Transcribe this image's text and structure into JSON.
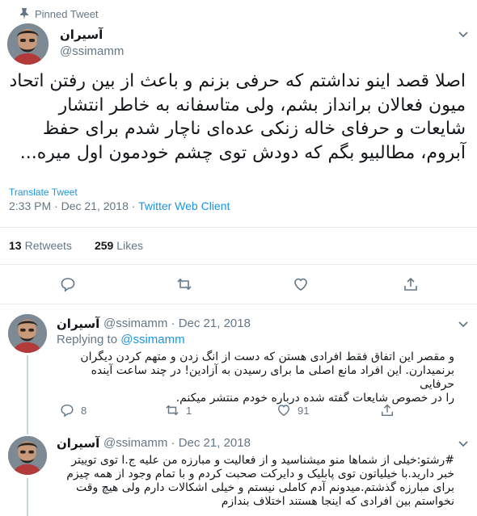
{
  "pinned": {
    "label": "Pinned Tweet"
  },
  "main_tweet": {
    "display_name": "آسیران",
    "handle": "@ssimamm",
    "text_lines": [
      "اصلا قصد اینو نداشتم که حرفی بزنم و باعث از بین رفتن اتحاد",
      "میون فعالان برانداز بشم، ولی متاسفانه به خاطر انتشار",
      "شایعات و حرفای خاله زنکی عده‌ای ناچار شدم برای حفظ",
      "آبروم، مطالبیو بگم که دودش توی چشم خودمون اول میره..."
    ],
    "translate_label": "Translate Tweet",
    "time": "2:33 PM · Dec 21, 2018 · ",
    "client": "Twitter Web Client",
    "retweets_count": "13",
    "retweets_label": "Retweets",
    "likes_count": "259",
    "likes_label": "Likes"
  },
  "replies": [
    {
      "display_name": "آسیران",
      "handle": "@ssimamm · Dec 21, 2018",
      "replying_prefix": "Replying to ",
      "replying_to": "@ssimamm",
      "text_lines": [
        "و مقصر این اتفاق فقط افرادی هستن که دست از انگ زدن و متهم کردن دیگران",
        "برنمیدارن. این افراد مانع اصلی ما برای رسیدن به آزادین! در چند ساعت  آینده حرفایی",
        "را در خصوص شایعات گفته شده درباره خودم منتشر میکنم."
      ],
      "reply_count": "8",
      "retweet_count": "1",
      "like_count": "91"
    },
    {
      "display_name": "آسیران",
      "handle": "@ssimamm · Dec 21, 2018",
      "text_lines": [
        "#رشتو:خیلی از شماها منو میشناسید و از فعالیت و مبارزه من علیه ج.ا توی توییتر",
        "خبر دارید.با خیلیاتون توی پابلیک و دایرکت صحبت کردم و با تمام وجود از همه چیزم",
        "برای مبارزه گذشتم.میدونم آدم کاملی نیستم و خیلی اشکالات دارم ولی هیچ وقت",
        "نخواستم بین افرادی که اینجا هستند اختلاف بندازم"
      ]
    }
  ],
  "colors": {
    "link": "#1b95e0",
    "muted": "#657786",
    "text": "#14171a",
    "divider": "#e6ecf0"
  },
  "icons": [
    "pin-icon",
    "chevron-down-icon",
    "reply-icon",
    "retweet-icon",
    "like-icon",
    "share-icon"
  ]
}
